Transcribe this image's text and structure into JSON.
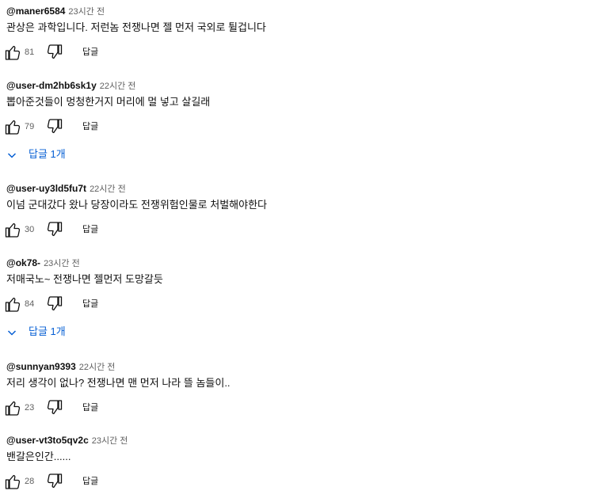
{
  "comments": [
    {
      "author": "@maner6584",
      "time": "23시간 전",
      "text": "관상은 과학입니다. 저런놈 전쟁나면 젤 먼저 국외로 튈겁니다",
      "likes": "81",
      "reply_label": "답글"
    },
    {
      "author": "@user-dm2hb6sk1y",
      "time": "22시간 전",
      "text": "뽑아준것들이 멍청한거지 머리에 멀 넣고 살길래",
      "likes": "79",
      "reply_label": "답글",
      "replies_label": "답글 1개"
    },
    {
      "author": "@user-uy3ld5fu7t",
      "time": "22시간 전",
      "text": "이넘 군대갔다 왔나 당장이라도 전쟁위험인물로 처벌해야한다",
      "likes": "30",
      "reply_label": "답글"
    },
    {
      "author": "@ok78-",
      "time": "23시간 전",
      "text": "저매국노~ 전쟁나면 젤먼저 도망갈듯",
      "likes": "84",
      "reply_label": "답글",
      "replies_label": "답글 1개"
    },
    {
      "author": "@sunnyan9393",
      "time": "22시간 전",
      "text": "저리 생각이 없나? 전쟁나면 맨 먼저 나라 뜰 놈들이..",
      "likes": "23",
      "reply_label": "답글"
    },
    {
      "author": "@user-vt3to5qv2c",
      "time": "23시간 전",
      "text": "밴갈은인간......",
      "likes": "28",
      "reply_label": "답글"
    }
  ],
  "icons": {
    "like": "thumbs-up-icon",
    "dislike": "thumbs-down-icon",
    "expand": "chevron-down-icon"
  },
  "colors": {
    "text": "#0f0f0f",
    "secondary": "#606060",
    "link": "#065fd4"
  }
}
